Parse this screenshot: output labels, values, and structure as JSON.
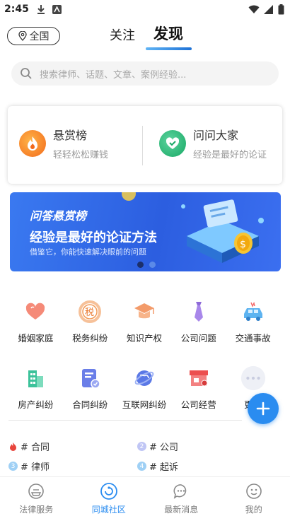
{
  "status_bar": {
    "time": "2:45"
  },
  "top_nav": {
    "location": "全国",
    "tab_follow": "关注",
    "tab_discover": "发现"
  },
  "search": {
    "placeholder": "搜索律师、话题、文章、案例经验..."
  },
  "reward_card": {
    "left": {
      "title": "悬赏榜",
      "subtitle": "轻轻松松赚钱"
    },
    "right": {
      "title": "问问大家",
      "subtitle": "经验是最好的论证"
    }
  },
  "banner": {
    "title": "问答悬赏榜",
    "headline": "经验是最好的论证方法",
    "subtitle": "借鉴它，你能快速解决眼前的问题"
  },
  "categories": [
    {
      "label": "婚姻家庭",
      "icon": "heart-icon"
    },
    {
      "label": "税务纠纷",
      "icon": "tax-icon"
    },
    {
      "label": "知识产权",
      "icon": "graduation-cap-icon"
    },
    {
      "label": "公司问题",
      "icon": "tie-icon"
    },
    {
      "label": "交通事故",
      "icon": "car-accident-icon"
    },
    {
      "label": "房产纠纷",
      "icon": "building-icon"
    },
    {
      "label": "合同纠纷",
      "icon": "contract-icon"
    },
    {
      "label": "互联网纠纷",
      "icon": "globe-icon"
    },
    {
      "label": "公司经营",
      "icon": "store-icon"
    },
    {
      "label": "更多",
      "icon": "more-icon"
    }
  ],
  "hot_topics": [
    {
      "rank": "",
      "text": "# 合同"
    },
    {
      "rank": "2",
      "text": "# 公司"
    },
    {
      "rank": "3",
      "text": "# 律师"
    },
    {
      "rank": "4",
      "text": "# 起诉"
    }
  ],
  "bottom_nav": [
    {
      "label": "法律服务",
      "icon": "law-service-icon",
      "active": false
    },
    {
      "label": "同城社区",
      "icon": "community-icon",
      "active": true
    },
    {
      "label": "最新消息",
      "icon": "message-icon",
      "active": false
    },
    {
      "label": "我的",
      "icon": "profile-icon",
      "active": false
    }
  ],
  "colors": {
    "accent": "#2a8cf0",
    "banner_blue": "#2c5ee0"
  }
}
